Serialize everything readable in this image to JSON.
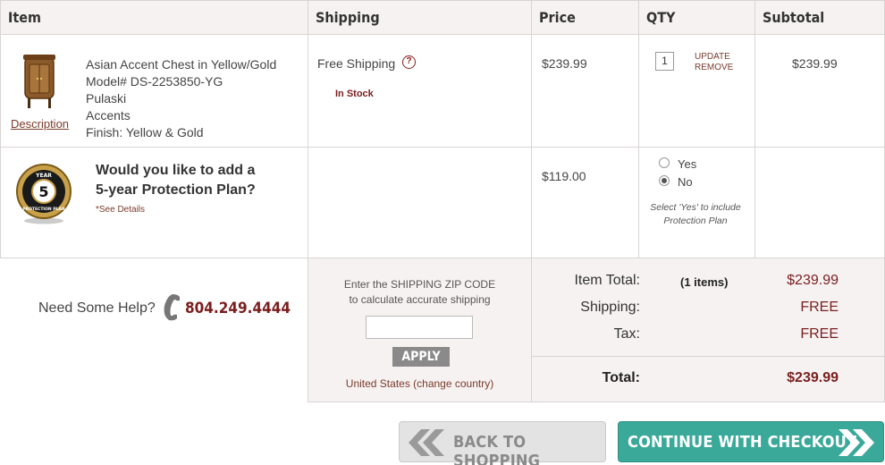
{
  "columns": {
    "item": "Item",
    "shipping": "Shipping",
    "price": "Price",
    "qty": "QTY",
    "subtotal": "Subtotal"
  },
  "product": {
    "description_link": "Description",
    "name": "Asian Accent Chest in Yellow/Gold",
    "model": "Model# DS-2253850-YG",
    "brand": "Pulaski",
    "category": "Accents",
    "finish": "Finish: Yellow & Gold",
    "shipping": "Free Shipping",
    "stock": "In Stock",
    "price": "$239.99",
    "qty": "1",
    "update": "UPDATE",
    "remove": "REMOVE",
    "subtotal": "$239.99"
  },
  "protection": {
    "badge_top": "YEAR",
    "badge_num": "5",
    "badge_bottom": "PROTECTION PLAN",
    "question_line1": "Would you like to add a",
    "question_line2": "5-year Protection Plan?",
    "details": "*See Details",
    "price": "$119.00",
    "yes": "Yes",
    "no": "No",
    "selected": "No",
    "hint_line1": "Select 'Yes' to include",
    "hint_line2": "Protection Plan"
  },
  "help": {
    "label": "Need Some Help?",
    "phone": "804.249.4444"
  },
  "zip": {
    "line1": "Enter the SHIPPING ZIP CODE",
    "line2": "to calculate accurate shipping",
    "value": "",
    "apply": "APPLY",
    "country": "United States (change country)"
  },
  "totals": {
    "item_total_label": "Item Total:",
    "items_count": "(1 items)",
    "item_total": "$239.99",
    "shipping_label": "Shipping:",
    "shipping": "FREE",
    "tax_label": "Tax:",
    "tax": "FREE",
    "total_label": "Total:",
    "total": "$239.99"
  },
  "buttons": {
    "back": "BACK TO SHOPPING",
    "checkout": "CONTINUE WITH CHECKOUT"
  },
  "colors": {
    "accent": "#7a1e1e",
    "checkout": "#3aa99a",
    "header_bg": "#f6f2f2"
  }
}
